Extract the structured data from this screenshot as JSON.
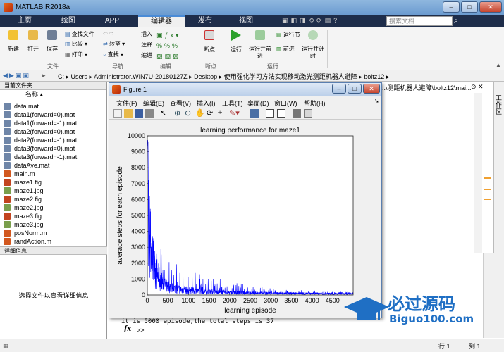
{
  "app": {
    "title": "MATLAB R2018a"
  },
  "tabs": [
    "主页",
    "绘图",
    "APP",
    "编辑器",
    "发布",
    "视图"
  ],
  "active_tab": "编辑器",
  "search": {
    "placeholder": "搜索文档"
  },
  "toolstrip": {
    "file": {
      "new": "新建",
      "open": "打开",
      "save": "保存",
      "find_files": "查找文件",
      "compare": "比较",
      "print": "打印",
      "group": "文件"
    },
    "nav": {
      "goto": "转至",
      "find": "查找",
      "group": "导航"
    },
    "edit": {
      "insert": "插入",
      "comment": "注释",
      "indent": "缩进",
      "group": "编辑"
    },
    "breakpoints": {
      "label": "断点",
      "group": "断点"
    },
    "run": {
      "run": "运行",
      "run_advance": "运行并前进",
      "run_section": "运行节",
      "advance": "前进",
      "run_time": "运行并计时",
      "group": "运行"
    }
  },
  "address": {
    "parts": [
      "C:",
      "Users",
      "Administrator.WIN7U-20180127Z",
      "Desktop",
      "使用强化学习方法实现移动激光测距机器人避障",
      "boltz12"
    ]
  },
  "current_folder": {
    "title": "当前文件夹",
    "col_name": "名称",
    "files": [
      "data.mat",
      "data1(forward=0).mat",
      "data1(forward=-1).mat",
      "data2(forward=0).mat",
      "data2(forward=-1).mat",
      "data3(forward=0).mat",
      "data3(forward=-1).mat",
      "dataAve.mat",
      "main.m",
      "maze1.fig",
      "maze1.jpg",
      "maze2.fig",
      "maze2.jpg",
      "maze3.fig",
      "maze3.jpg",
      "posNorm.m",
      "randAction.m"
    ]
  },
  "details": {
    "title": "详细信息",
    "empty_msg": "选择文件以查看详细信息"
  },
  "editor_path": "..\\测距机器人避障\\boltz12\\mai...",
  "workspace_label": "工作区",
  "figure": {
    "title": "Figure 1",
    "menu": [
      "文件(F)",
      "编辑(E)",
      "查看(V)",
      "插入(I)",
      "工具(T)",
      "桌面(D)",
      "窗口(W)",
      "帮助(H)"
    ]
  },
  "chart_data": {
    "type": "line",
    "title": "learning performance for maze1",
    "xlabel": "learning episode",
    "ylabel": "average steps for each episode",
    "xlim": [
      0,
      5000
    ],
    "ylim": [
      0,
      10000
    ],
    "xticks": [
      0,
      500,
      1000,
      1500,
      2000,
      2500,
      3000,
      3500,
      4000,
      4500
    ],
    "yticks": [
      0,
      1000,
      2000,
      3000,
      4000,
      5000,
      6000,
      7000,
      8000,
      9000,
      10000
    ],
    "color": "#0000ff"
  },
  "command": {
    "output": "it is 5000 episode,the total steps is 37",
    "prompt": ">>"
  },
  "status": {
    "row_label": "行",
    "row": "1",
    "col_label": "列",
    "col": "1"
  },
  "watermark": {
    "title": "必过源码",
    "url": "Biguo100.com"
  }
}
